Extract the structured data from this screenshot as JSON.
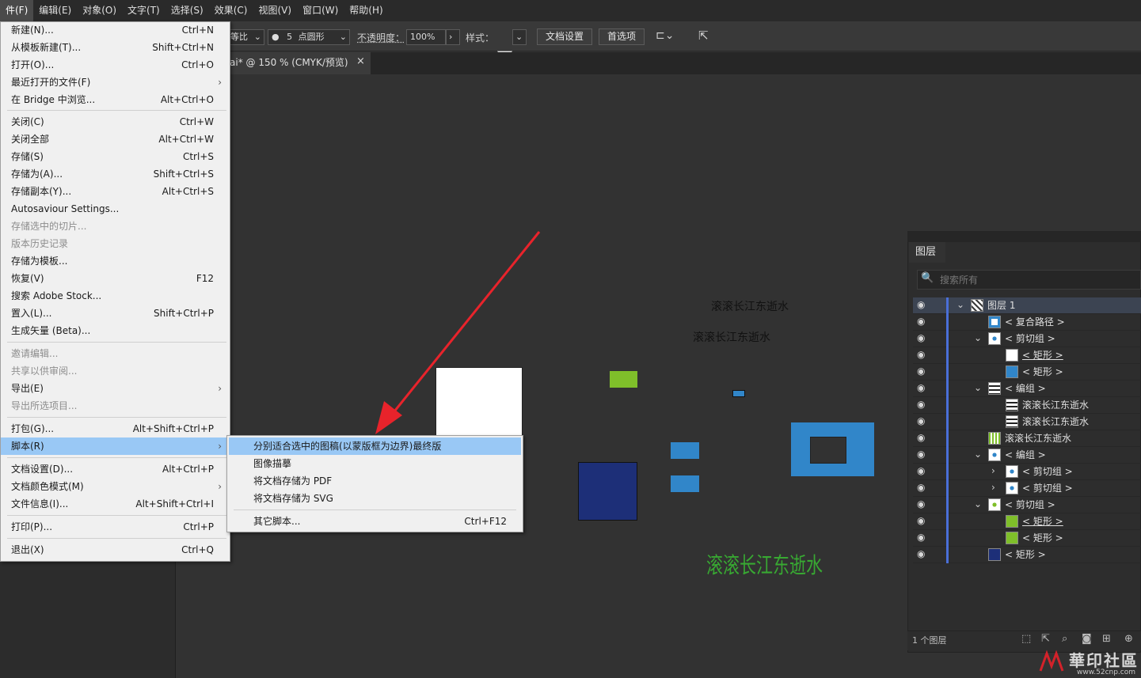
{
  "menubar": {
    "items": [
      "件(F)",
      "编辑(E)",
      "对象(O)",
      "文字(T)",
      "选择(S)",
      "效果(C)",
      "视图(V)",
      "窗口(W)",
      "帮助(H)"
    ]
  },
  "controlbar": {
    "ratio_label": "等比",
    "brush_size": "5",
    "brush_shape": "点圆形",
    "opacity_label": "不透明度：",
    "opacity_value": "100%",
    "style_label": "样式：",
    "doc_settings_button": "文档设置",
    "preferences_button": "首选项"
  },
  "document_tab": {
    "title": "ai* @ 150 % (CMYK/预览)",
    "close": "×"
  },
  "file_menu": {
    "items": [
      {
        "label": "新建(N)...",
        "shortcut": "Ctrl+N"
      },
      {
        "label": "从模板新建(T)...",
        "shortcut": "Shift+Ctrl+N"
      },
      {
        "label": "打开(O)...",
        "shortcut": "Ctrl+O"
      },
      {
        "label": "最近打开的文件(F)",
        "shortcut": ""
      },
      {
        "label": "在 Bridge 中浏览...",
        "shortcut": "Alt+Ctrl+O"
      },
      {
        "label": "关闭(C)",
        "shortcut": "Ctrl+W"
      },
      {
        "label": "关闭全部",
        "shortcut": "Alt+Ctrl+W"
      },
      {
        "label": "存储(S)",
        "shortcut": "Ctrl+S"
      },
      {
        "label": "存储为(A)...",
        "shortcut": "Shift+Ctrl+S"
      },
      {
        "label": "存储副本(Y)...",
        "shortcut": "Alt+Ctrl+S"
      },
      {
        "label": "Autosaviour Settings...",
        "shortcut": ""
      },
      {
        "label": "存储选中的切片...",
        "shortcut": ""
      },
      {
        "label": "版本历史记录",
        "shortcut": ""
      },
      {
        "label": "存储为模板...",
        "shortcut": ""
      },
      {
        "label": "恢复(V)",
        "shortcut": "F12"
      },
      {
        "label": "搜索 Adobe Stock...",
        "shortcut": ""
      },
      {
        "label": "置入(L)...",
        "shortcut": "Shift+Ctrl+P"
      },
      {
        "label": "生成矢量 (Beta)...",
        "shortcut": ""
      },
      {
        "label": "邀请编辑...",
        "shortcut": ""
      },
      {
        "label": "共享以供审阅...",
        "shortcut": ""
      },
      {
        "label": "导出(E)",
        "shortcut": ""
      },
      {
        "label": "导出所选项目...",
        "shortcut": ""
      },
      {
        "label": "打包(G)...",
        "shortcut": "Alt+Shift+Ctrl+P"
      },
      {
        "label": "脚本(R)",
        "shortcut": ""
      },
      {
        "label": "文档设置(D)...",
        "shortcut": "Alt+Ctrl+P"
      },
      {
        "label": "文档颜色模式(M)",
        "shortcut": ""
      },
      {
        "label": "文件信息(I)...",
        "shortcut": "Alt+Shift+Ctrl+I"
      },
      {
        "label": "打印(P)...",
        "shortcut": "Ctrl+P"
      },
      {
        "label": "退出(X)",
        "shortcut": "Ctrl+Q"
      }
    ]
  },
  "script_submenu": {
    "items": [
      {
        "label": "分别适合选中的图稿(以蒙版框为边界)最终版",
        "shortcut": ""
      },
      {
        "label": "图像描摹",
        "shortcut": ""
      },
      {
        "label": "将文档存储为 PDF",
        "shortcut": ""
      },
      {
        "label": "将文档存储为 SVG",
        "shortcut": ""
      },
      {
        "label": "其它脚本...",
        "shortcut": "Ctrl+F12"
      }
    ]
  },
  "artwork": {
    "text_1": "滚滚长江东逝水",
    "text_2": "滚滚长江东逝水",
    "text_3": "滚滚长江东逝水"
  },
  "layers_panel": {
    "tab": "图层",
    "search_placeholder": "搜索所有",
    "rows": [
      {
        "name": "图层 1",
        "underline": false
      },
      {
        "name": "< 复合路径 >",
        "underline": false
      },
      {
        "name": "< 剪切组 >",
        "underline": false
      },
      {
        "name": "< 矩形 >",
        "underline": true
      },
      {
        "name": "< 矩形 >",
        "underline": false
      },
      {
        "name": "< 编组 >",
        "underline": false
      },
      {
        "name": "滚滚长江东逝水",
        "underline": false
      },
      {
        "name": "滚滚长江东逝水",
        "underline": false
      },
      {
        "name": "滚滚长江东逝水",
        "underline": false
      },
      {
        "name": "< 编组 >",
        "underline": false
      },
      {
        "name": "< 剪切组 >",
        "underline": false
      },
      {
        "name": "< 剪切组 >",
        "underline": false
      },
      {
        "name": "< 剪切组 >",
        "underline": false
      },
      {
        "name": "< 矩形 >",
        "underline": true
      },
      {
        "name": "< 矩形 >",
        "underline": false
      },
      {
        "name": "< 矩形 >",
        "underline": false
      }
    ],
    "footer_count": "1 个图层"
  },
  "watermark": {
    "brand": "華印社區",
    "url": "www.52cnp.com"
  },
  "colors": {
    "menu_highlight": "#99c8f5",
    "arrow_red": "#e8232b",
    "artwork_blue": "#3186c9",
    "artwork_green": "#7fbf2a",
    "artwork_navy": "#1d2f78",
    "layer_select": "#4a6fd8"
  }
}
